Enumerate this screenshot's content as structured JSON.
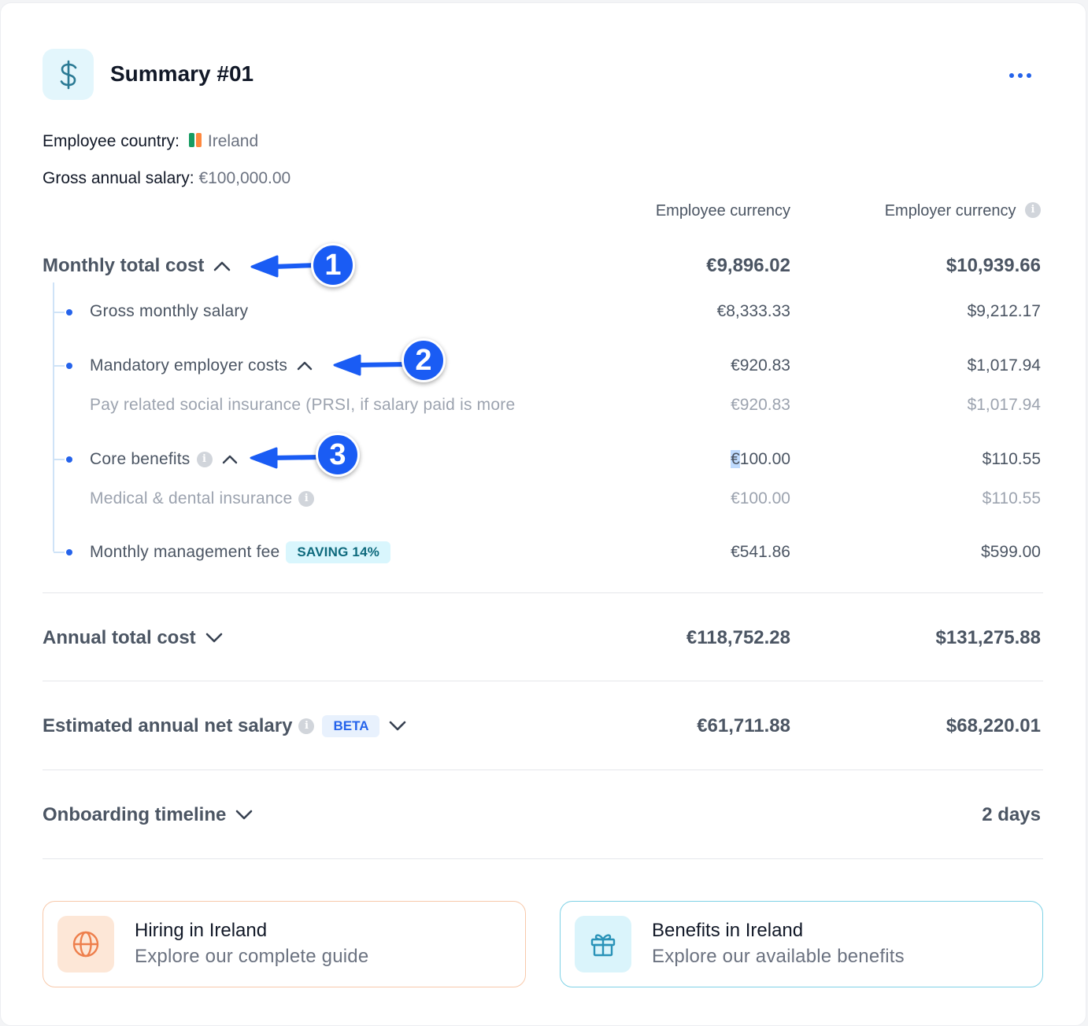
{
  "header": {
    "title": "Summary #01"
  },
  "meta": {
    "country_label": "Employee country:",
    "country_value": "Ireland",
    "salary_label": "Gross annual salary:",
    "salary_value": "€100,000.00"
  },
  "columns": {
    "employee": "Employee currency",
    "employer": "Employer currency"
  },
  "monthly": {
    "label": "Monthly total cost",
    "employee": "€9,896.02",
    "employer": "$10,939.66",
    "items": [
      {
        "label": "Gross monthly salary",
        "employee": "€8,333.33",
        "employer": "$9,212.17"
      },
      {
        "label": "Mandatory employer costs",
        "employee": "€920.83",
        "employer": "$1,017.94",
        "sub": {
          "label": "Pay related social insurance (PRSI, if salary paid is more",
          "employee": "€920.83",
          "employer": "$1,017.94"
        }
      },
      {
        "label": "Core benefits",
        "employee_symbol": "€",
        "employee_amount": "100.00",
        "employer": "$110.55",
        "sub": {
          "label": "Medical & dental insurance",
          "employee": "€100.00",
          "employer": "$110.55"
        }
      },
      {
        "label": "Monthly management fee",
        "badge": "SAVING 14%",
        "employee": "€541.86",
        "employer": "$599.00"
      }
    ]
  },
  "annual": {
    "label": "Annual total cost",
    "employee": "€118,752.28",
    "employer": "$131,275.88"
  },
  "net": {
    "label": "Estimated annual net salary",
    "badge": "BETA",
    "employee": "€61,711.88",
    "employer": "$68,220.01"
  },
  "onboarding": {
    "label": "Onboarding timeline",
    "value": "2 days"
  },
  "markers": [
    "1",
    "2",
    "3"
  ],
  "cards": [
    {
      "title": "Hiring in Ireland",
      "subtitle": "Explore our complete guide"
    },
    {
      "title": "Benefits in Ireland",
      "subtitle": "Explore our available benefits"
    }
  ],
  "colors": {
    "accent": "#2563eb",
    "marker": "#1a5cf4",
    "flag_green": "#169b62",
    "flag_orange": "#ff883e",
    "hiring_card_border": "#f8c9ab",
    "benefits_card_border": "#7fd2e6"
  },
  "icons": {
    "header": "dollar-icon",
    "more": "more-horizontal-icon",
    "info": "info-icon",
    "chevron_up": "chevron-up-icon",
    "chevron_down": "chevron-down-icon",
    "hiring": "globe-icon",
    "benefits": "gift-icon",
    "annotation_arrow": "arrow-left-icon"
  }
}
